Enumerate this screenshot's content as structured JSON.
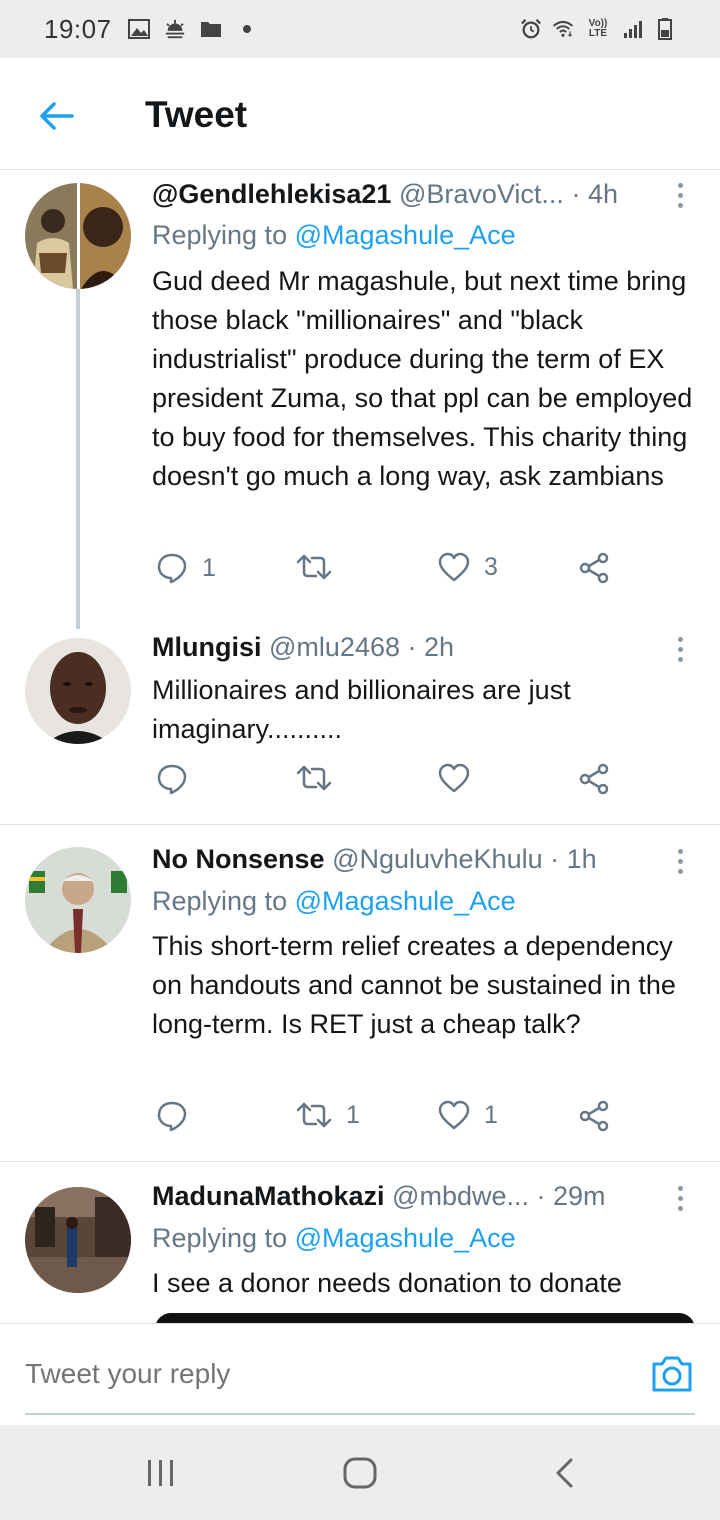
{
  "status_bar": {
    "time": "19:07",
    "left_icons": [
      "image-icon",
      "weather-icon",
      "folder-icon",
      "dot-icon"
    ],
    "right_icons": [
      "alarm-icon",
      "wifi-icon",
      "volte-icon",
      "signal-icon",
      "battery-icon"
    ],
    "volte_top": "Vo))",
    "volte_bottom": "LTE"
  },
  "header": {
    "title": "Tweet",
    "back_icon": "arrow-left-icon"
  },
  "tweets": [
    {
      "name": "@Gendlehlekisa21",
      "handle": "@BravoVict...",
      "time": "· 4h",
      "replying_prefix": "Replying to",
      "replying_handle": "@Magashule_Ace",
      "text": "Gud deed Mr magashule, but next time bring those black \"millionaires\" and \"black industrialist\" produce during the term of EX president Zuma, so that ppl can be employed to buy food for themselves. This charity thing doesn't go much a long way, ask zambians",
      "replies": "1",
      "retweets": "",
      "likes": "3"
    },
    {
      "name": "Mlungisi",
      "handle": "@mlu2468",
      "time": "· 2h",
      "text": "Millionaires and billionaires are just imaginary..........",
      "replies": "",
      "retweets": "",
      "likes": ""
    },
    {
      "name": "No Nonsense",
      "handle": "@NguluvheKhulu",
      "time": "· 1h",
      "replying_prefix": "Replying to",
      "replying_handle": "@Magashule_Ace",
      "text": "This short-term relief creates a dependency on handouts and cannot be sustained in the long-term. Is RET just a cheap talk?",
      "replies": "",
      "retweets": "1",
      "likes": "1"
    },
    {
      "name": "MadunaMathokazi",
      "handle": "@mbdwe...",
      "time": "· 29m",
      "replying_prefix": "Replying to",
      "replying_handle": "@Magashule_Ace",
      "text": "I see a donor needs donation to donate"
    }
  ],
  "composer": {
    "placeholder": "Tweet your reply",
    "camera_icon": "camera-icon"
  },
  "nav_bar": {
    "icons": [
      "recents-icon",
      "home-icon",
      "back-icon"
    ]
  },
  "colors": {
    "accent": "#1da1f2",
    "text": "#14171a",
    "secondary_text": "#657786",
    "divider": "#dfe3e6",
    "system_bar": "#ededed"
  }
}
